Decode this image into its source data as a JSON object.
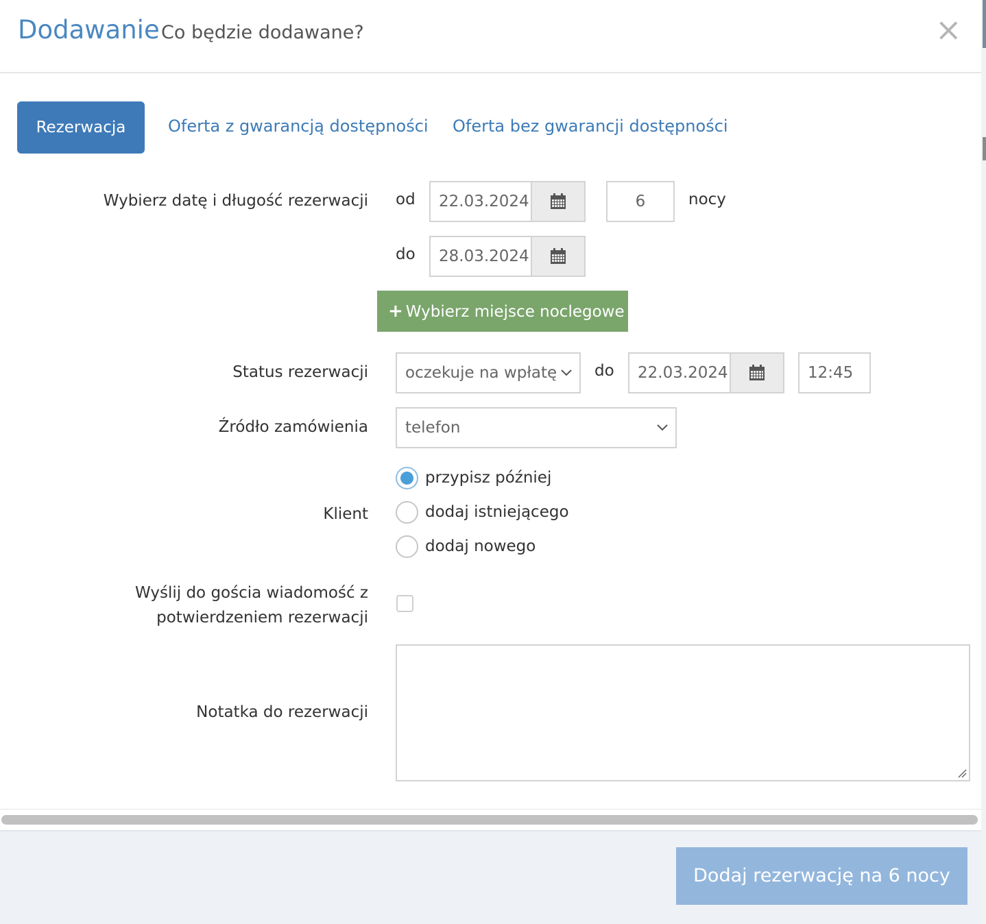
{
  "header": {
    "title": "Dodawanie",
    "subtitle": "Co będzie dodawane?",
    "close_glyph": "×"
  },
  "tabs": [
    {
      "label": "Rezerwacja",
      "active": true
    },
    {
      "label": "Oferta z gwarancją dostępności",
      "active": false
    },
    {
      "label": "Oferta bez gwarancji dostępności",
      "active": false
    }
  ],
  "dates": {
    "label": "Wybierz datę i długość rezerwacji",
    "from_word": "od",
    "from_value": "22.03.2024",
    "to_word": "do",
    "to_value": "28.03.2024",
    "nights_value": "6",
    "nights_word": "nocy"
  },
  "choose_place_button": {
    "label": "Wybierz miejsce noclegowe",
    "icon": "plus-icon"
  },
  "status": {
    "label": "Status rezerwacji",
    "selected": "oczekuje na wpłatę",
    "until_word": "do",
    "until_date": "22.03.2024",
    "until_time": "12:45"
  },
  "source": {
    "label": "Źródło zamówienia",
    "selected": "telefon"
  },
  "client": {
    "label": "Klient",
    "options": [
      {
        "label": "przypisz później",
        "checked": true
      },
      {
        "label": "dodaj istniejącego",
        "checked": false
      },
      {
        "label": "dodaj nowego",
        "checked": false
      }
    ]
  },
  "send_message": {
    "label_line1": "Wyślij do gościa wiadomość z",
    "label_line2": "potwierdzeniem rezerwacji",
    "checked": false
  },
  "note": {
    "label": "Notatka do rezerwacji",
    "value": ""
  },
  "footer": {
    "submit_label": "Dodaj rezerwację na 6 nocy"
  },
  "colors": {
    "accent": "#3f7ab8",
    "title": "#4a87c0",
    "green": "#7aa56b",
    "submit_disabled": "#93b6dc",
    "radio_on": "#4a9fd8"
  }
}
